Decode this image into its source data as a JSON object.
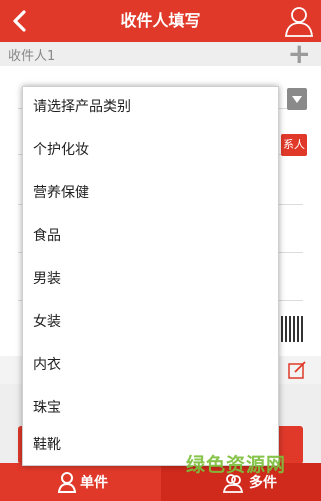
{
  "header": {
    "title": "收件人填写",
    "back_icon": "chevron-left-icon",
    "user_icon": "user-outline-icon"
  },
  "subheader": {
    "recipient_label": "收件人1",
    "add_icon": "plus-icon"
  },
  "form": {
    "red_button_label": "系人"
  },
  "dropdown": {
    "options": [
      "请选择产品类别",
      "个护化妆",
      "营养保健",
      "食品",
      "男装",
      "女装",
      "内衣",
      "珠宝",
      "鞋靴"
    ]
  },
  "tabs": {
    "single_label": "单件",
    "multi_label": "多件"
  },
  "watermark": "绿色资源网",
  "colors": {
    "brand_red": "#e0392a",
    "dark_red": "#d02a1c",
    "watermark_green": "#7dbf3c"
  }
}
